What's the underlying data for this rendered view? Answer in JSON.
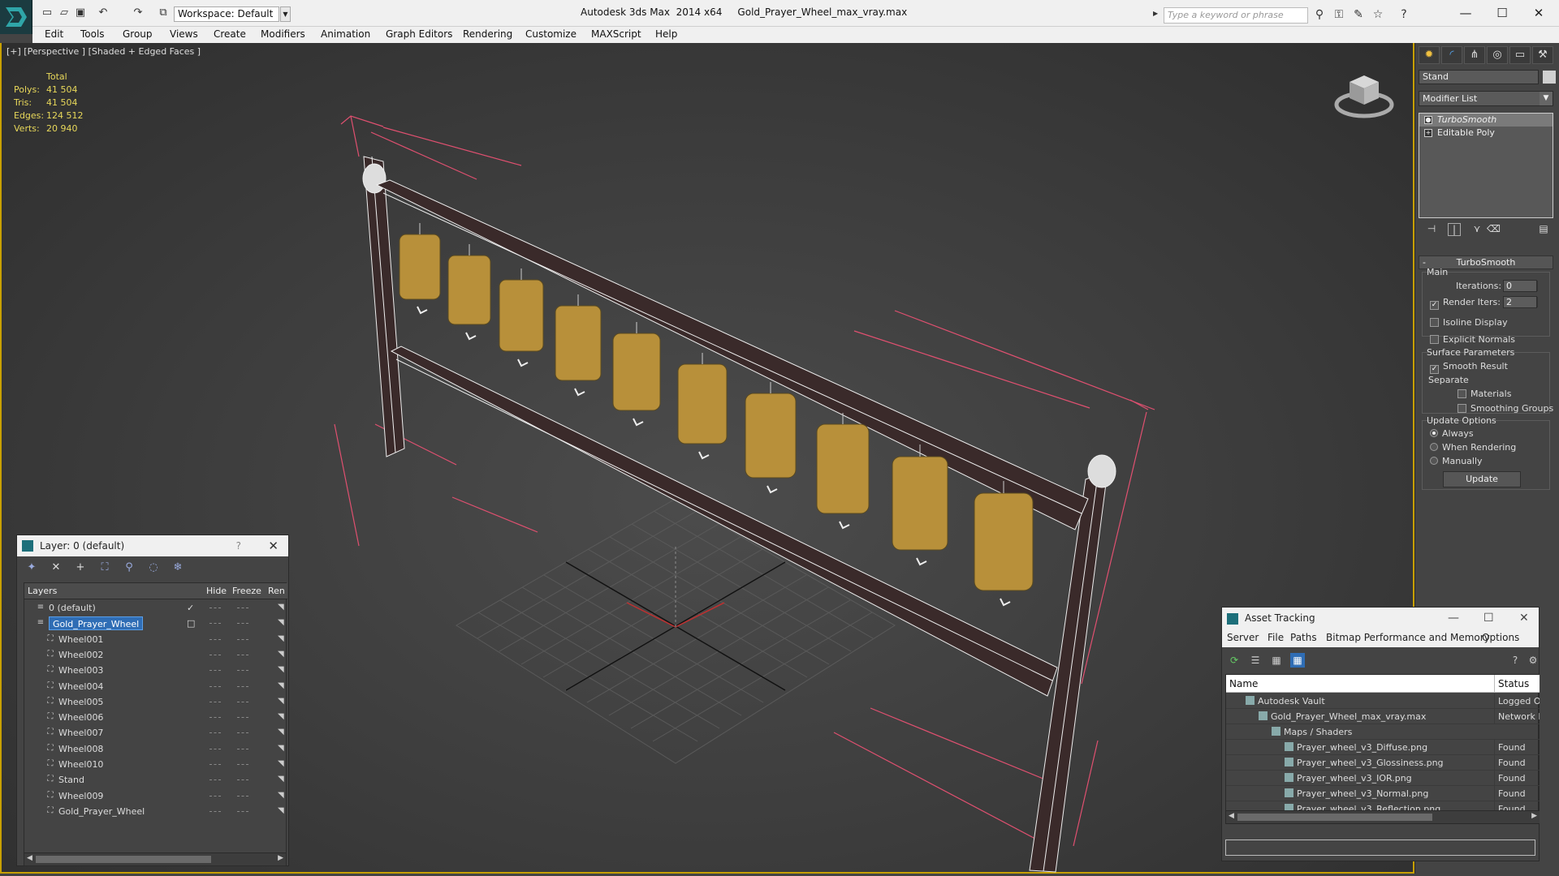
{
  "app": {
    "title": "Autodesk 3ds Max  2014 x64     Gold_Prayer_Wheel_max_vray.max",
    "workspace": "Workspace: Default",
    "search_placeholder": "Type a keyword or phrase",
    "accent": "#c8a000"
  },
  "menubar": [
    "Edit",
    "Tools",
    "Group",
    "Views",
    "Create",
    "Modifiers",
    "Animation",
    "Graph Editors",
    "Rendering",
    "Customize",
    "MAXScript",
    "Help"
  ],
  "viewport": {
    "label": "[+] [Perspective ] [Shaded + Edged Faces ]",
    "stats": {
      "header": "Total",
      "rows": [
        {
          "label": "Polys:",
          "value": "41 504"
        },
        {
          "label": "Tris:",
          "value": "41 504"
        },
        {
          "label": "Edges:",
          "value": "124 512"
        },
        {
          "label": "Verts:",
          "value": "20 940"
        }
      ]
    }
  },
  "command_panel": {
    "object_name": "Stand",
    "modifier_list": "Modifier List",
    "stack": [
      {
        "label": "TurboSmooth",
        "selected": true
      },
      {
        "label": "Editable Poly",
        "selected": false
      }
    ],
    "turbosmooth": {
      "title": "TurboSmooth",
      "main": "Main",
      "iterations_label": "Iterations:",
      "iterations": "0",
      "render_iters_label": "Render Iters:",
      "render_iters": "2",
      "render_iters_checked": true,
      "isoline": "Isoline Display",
      "explicit_normals": "Explicit Normals",
      "surface_params": "Surface Parameters",
      "smooth_result": "Smooth Result",
      "separate": "Separate",
      "materials": "Materials",
      "smoothing_groups": "Smoothing Groups",
      "update_options": "Update Options",
      "always": "Always",
      "when_rendering": "When Rendering",
      "manually": "Manually",
      "update_button": "Update"
    }
  },
  "layer_dialog": {
    "title": "Layer: 0 (default)",
    "help": "?",
    "columns": {
      "layers": "Layers",
      "hide": "Hide",
      "freeze": "Freeze",
      "render": "Ren"
    },
    "rows": [
      {
        "name": "0 (default)",
        "level": 0,
        "kind": "layer"
      },
      {
        "name": "Gold_Prayer_Wheel",
        "level": 0,
        "kind": "layer",
        "selected": true
      },
      {
        "name": "Wheel001",
        "level": 1,
        "kind": "object"
      },
      {
        "name": "Wheel002",
        "level": 1,
        "kind": "object"
      },
      {
        "name": "Wheel003",
        "level": 1,
        "kind": "object"
      },
      {
        "name": "Wheel004",
        "level": 1,
        "kind": "object"
      },
      {
        "name": "Wheel005",
        "level": 1,
        "kind": "object"
      },
      {
        "name": "Wheel006",
        "level": 1,
        "kind": "object"
      },
      {
        "name": "Wheel007",
        "level": 1,
        "kind": "object"
      },
      {
        "name": "Wheel008",
        "level": 1,
        "kind": "object"
      },
      {
        "name": "Wheel010",
        "level": 1,
        "kind": "object"
      },
      {
        "name": "Stand",
        "level": 1,
        "kind": "object"
      },
      {
        "name": "Wheel009",
        "level": 1,
        "kind": "object"
      },
      {
        "name": "Gold_Prayer_Wheel",
        "level": 1,
        "kind": "object"
      }
    ]
  },
  "asset_tracking": {
    "title": "Asset Tracking",
    "menu": [
      "Server",
      "File",
      "Paths",
      "Bitmap Performance and Memory",
      "Options"
    ],
    "columns": {
      "name": "Name",
      "status": "Status"
    },
    "rows": [
      {
        "name": "Autodesk Vault",
        "status": "Logged O",
        "level": 1
      },
      {
        "name": "Gold_Prayer_Wheel_max_vray.max",
        "status": "Network F",
        "level": 2
      },
      {
        "name": "Maps / Shaders",
        "status": "",
        "level": 3
      },
      {
        "name": "Prayer_wheel_v3_Diffuse.png",
        "status": "Found",
        "level": 4
      },
      {
        "name": "Prayer_wheel_v3_Glossiness.png",
        "status": "Found",
        "level": 4
      },
      {
        "name": "Prayer_wheel_v3_IOR.png",
        "status": "Found",
        "level": 4
      },
      {
        "name": "Prayer_wheel_v3_Normal.png",
        "status": "Found",
        "level": 4
      },
      {
        "name": "Prayer_wheel_v3_Reflection.png",
        "status": "Found",
        "level": 4
      }
    ]
  }
}
